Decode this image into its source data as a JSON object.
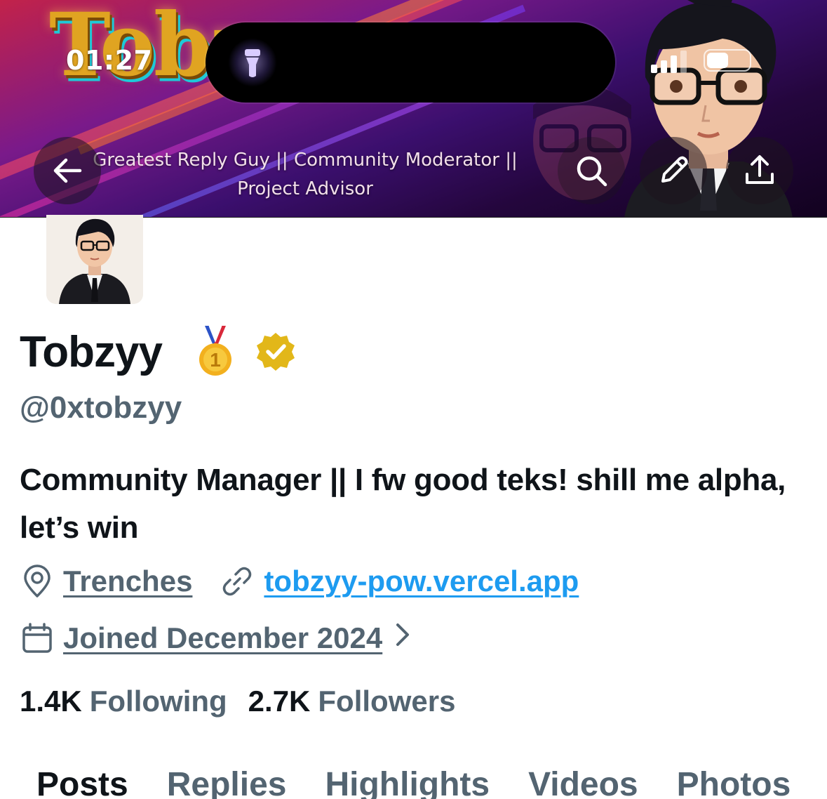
{
  "status_bar": {
    "time": "01:27"
  },
  "banner": {
    "logo_text": "Tobzyy",
    "tagline": "Greatest Reply Guy || Community Moderator || Project Advisor"
  },
  "header_actions": {
    "back_icon": "arrow-left-icon",
    "search_icon": "search-icon",
    "edit_icon": "pencil-icon",
    "share_icon": "share-icon"
  },
  "profile": {
    "display_name": "Tobzyy",
    "medal_icon": "first-place-medal-icon",
    "verified_badge": "verified-gold-badge",
    "handle": "@0xtobzyy",
    "bio": "Community Manager || I fw good teks! shill me alpha, let’s win",
    "location": "Trenches",
    "website": "tobzyy-pow.vercel.app",
    "joined": "Joined December 2024"
  },
  "stats": {
    "following_count": "1.4K",
    "following_label": "Following",
    "followers_count": "2.7K",
    "followers_label": "Followers"
  },
  "tabs": [
    {
      "label": "Posts",
      "active": true
    },
    {
      "label": "Replies",
      "active": false
    },
    {
      "label": "Highlights",
      "active": false
    },
    {
      "label": "Videos",
      "active": false
    },
    {
      "label": "Photos",
      "active": false
    }
  ],
  "colors": {
    "primary_text": "#0f1419",
    "secondary_text": "#536471",
    "link_blue": "#1d9bf0",
    "verified_gold": "#e2b719"
  }
}
